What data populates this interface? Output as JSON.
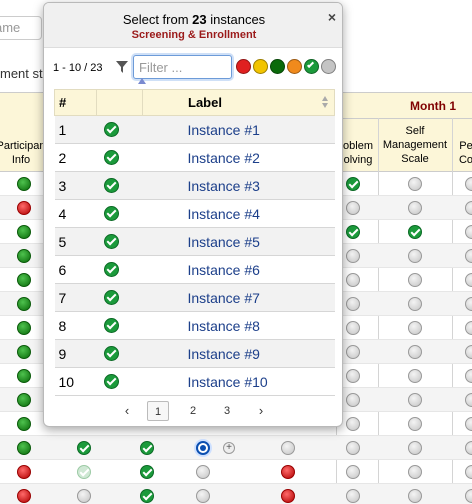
{
  "background": {
    "name_input_placeholder": "ame",
    "status_text": "ment sta",
    "month_label": "Month 1",
    "columns": {
      "participant_info": "Participan Info",
      "problem_solving": "oblem olving",
      "self_management": "Self Management Scale",
      "pe_co": "Pe Co"
    }
  },
  "popup": {
    "title_prefix": "Select from ",
    "title_count": "23",
    "title_suffix": " instances",
    "subtitle": "Screening & Enrollment",
    "close_label": "×",
    "range": "1 - 10 / 23",
    "filter_placeholder": "Filter ...",
    "legend_colors": [
      "#e02020",
      "#f2c400",
      "#0a6a0a",
      "#f08a1c",
      "#1b9a3b",
      "#c4c4c4"
    ],
    "header_num": "#",
    "header_label": "Label",
    "rows": [
      {
        "num": "1",
        "label": "Instance #1"
      },
      {
        "num": "2",
        "label": "Instance #2"
      },
      {
        "num": "3",
        "label": "Instance #3"
      },
      {
        "num": "4",
        "label": "Instance #4"
      },
      {
        "num": "5",
        "label": "Instance #5"
      },
      {
        "num": "6",
        "label": "Instance #6"
      },
      {
        "num": "7",
        "label": "Instance #7"
      },
      {
        "num": "8",
        "label": "Instance #8"
      },
      {
        "num": "9",
        "label": "Instance #9"
      },
      {
        "num": "10",
        "label": "Instance #10"
      }
    ],
    "pager": {
      "prev": "‹",
      "pages": [
        "1",
        "2",
        "3"
      ],
      "next": "›"
    }
  }
}
